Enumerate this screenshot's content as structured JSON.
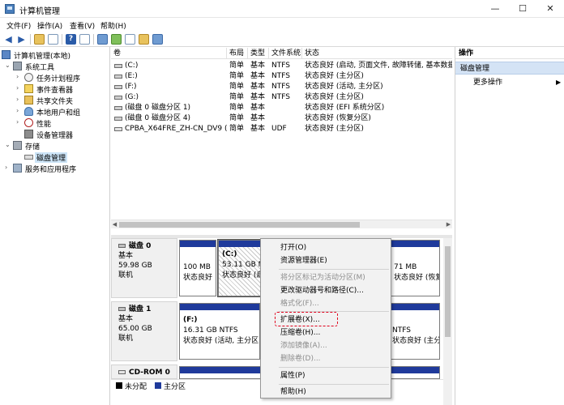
{
  "window": {
    "title": "计算机管理",
    "btn_min": "—",
    "btn_max": "☐",
    "btn_close": "✕"
  },
  "menubar": {
    "file": "文件(F)",
    "action": "操作(A)",
    "view": "查看(V)",
    "help": "帮助(H)"
  },
  "tree": {
    "root": "计算机管理(本地)",
    "system_tools": "系统工具",
    "task_scheduler": "任务计划程序",
    "event_viewer": "事件查看器",
    "shared_folders": "共享文件夹",
    "local_users": "本地用户和组",
    "performance": "性能",
    "device_manager": "设备管理器",
    "storage": "存储",
    "disk_management": "磁盘管理",
    "services_apps": "服务和应用程序"
  },
  "columns": {
    "volume": "卷",
    "layout": "布局",
    "type": "类型",
    "fs": "文件系统",
    "status": "状态"
  },
  "volumes": [
    {
      "name": "(C:)",
      "layout": "简单",
      "type": "基本",
      "fs": "NTFS",
      "status": "状态良好 (启动, 页面文件, 故障转储, 基本数据分"
    },
    {
      "name": "(E:)",
      "layout": "简单",
      "type": "基本",
      "fs": "NTFS",
      "status": "状态良好 (主分区)"
    },
    {
      "name": "(F:)",
      "layout": "简单",
      "type": "基本",
      "fs": "NTFS",
      "status": "状态良好 (活动, 主分区)"
    },
    {
      "name": "(G:)",
      "layout": "简单",
      "type": "基本",
      "fs": "NTFS",
      "status": "状态良好 (主分区)"
    },
    {
      "name": "(磁盘 0 磁盘分区 1)",
      "layout": "简单",
      "type": "基本",
      "fs": "",
      "status": "状态良好 (EFI 系统分区)"
    },
    {
      "name": "(磁盘 0 磁盘分区 4)",
      "layout": "简单",
      "type": "基本",
      "fs": "",
      "status": "状态良好 (恢复分区)"
    },
    {
      "name": "CPBA_X64FRE_ZH-CN_DV9 (D:)",
      "layout": "简单",
      "type": "基本",
      "fs": "UDF",
      "status": "状态良好 (主分区)"
    }
  ],
  "disks": [
    {
      "name": "磁盘 0",
      "kind": "基本",
      "size": "59.98 GB",
      "state": "联机",
      "parts": [
        {
          "line1": "",
          "line2": "100 MB",
          "line3": "状态良好"
        },
        {
          "line1": "(C:)",
          "line2": "53.11 GB N",
          "line3": "状态良好 (启"
        },
        {
          "line1": "",
          "line2": "71 MB",
          "line3": "状态良好 (恢复"
        }
      ]
    },
    {
      "name": "磁盘 1",
      "kind": "基本",
      "size": "65.00 GB",
      "state": "联机",
      "parts": [
        {
          "line1": "(F:)",
          "line2": "16.31 GB NTFS",
          "line3": "状态良好 (活动, 主分区)"
        },
        {
          "line1": "",
          "line2": "NTFS",
          "line3": "状态良好 (主分区)"
        }
      ]
    },
    {
      "name": "CD-ROM 0"
    }
  ],
  "legend": {
    "unallocated": "未分配",
    "primary": "主分区"
  },
  "actions": {
    "header": "操作",
    "section": "磁盘管理",
    "more": "更多操作"
  },
  "context_menu": {
    "open": "打开(O)",
    "explore": "资源管理器(E)",
    "mark_active": "将分区标记为活动分区(M)",
    "change_letter": "更改驱动器号和路径(C)...",
    "format": "格式化(F)...",
    "extend": "扩展卷(X)...",
    "shrink": "压缩卷(H)...",
    "add_mirror": "添加镜像(A)...",
    "delete": "删除卷(D)...",
    "properties": "属性(P)",
    "help": "帮助(H)"
  },
  "colors": {
    "primary_partition": "#1f3a9b",
    "unallocated": "#000000",
    "highlight": "#e0001b",
    "selection": "#cce4f7"
  }
}
